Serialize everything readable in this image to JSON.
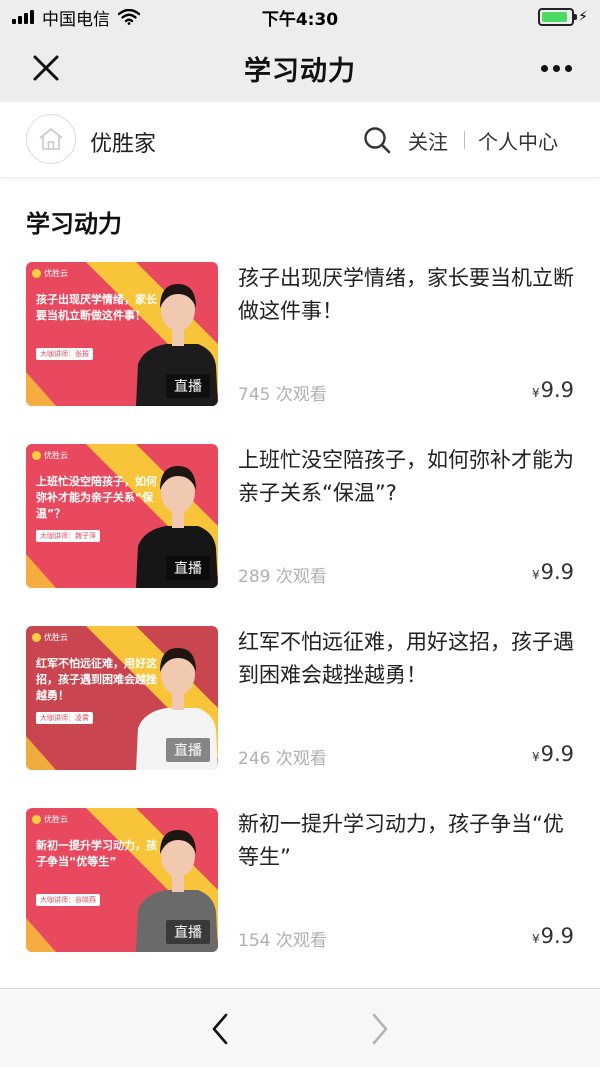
{
  "status_bar": {
    "carrier": "中国电信",
    "time": "下午4:30",
    "battery_level": 0.9,
    "signal_bars": 4
  },
  "nav": {
    "title": "学习动力"
  },
  "shop": {
    "name": "优胜家",
    "follow_label": "关注",
    "personal_center_label": "个人中心"
  },
  "section_title": "学习动力",
  "courses": [
    {
      "title": "孩子出现厌学情绪，家长要当机立断做这件事！",
      "views": "745 次观看",
      "price_symbol": "¥",
      "price": "9.9",
      "badge": "直播",
      "thumb_text": "孩子出现厌学情绪，家长要当机立断做这件事！",
      "thumb_teacher": "大咖讲师：张振",
      "thumb_brand": "优胜云",
      "thumb_bg": "#e9495e",
      "person_suit": "#1c1c1c"
    },
    {
      "title": "上班忙没空陪孩子，如何弥补才能为亲子关系“保温”?",
      "views": "289 次观看",
      "price_symbol": "¥",
      "price": "9.9",
      "badge": "直播",
      "thumb_text": "上班忙没空陪孩子，如何弥补才能为亲子关系“保温”？",
      "thumb_teacher": "大咖讲师：魏子萍",
      "thumb_brand": "优胜云",
      "thumb_bg": "#e9495e",
      "person_suit": "#161616"
    },
    {
      "title": "红军不怕远征难，用好这招，孩子遇到困难会越挫越勇！",
      "views": "246 次观看",
      "price_symbol": "¥",
      "price": "9.9",
      "badge": "直播",
      "thumb_text": "红军不怕远征难，用好这招，孩子遇到困难会越挫越勇！",
      "thumb_teacher": "大咖讲师：凌霄",
      "thumb_brand": "优胜云",
      "thumb_bg": "#c9454f",
      "person_suit": "#f4f4f4"
    },
    {
      "title": "新初一提升学习动力，孩子争当“优等生”",
      "views": "154 次观看",
      "price_symbol": "¥",
      "price": "9.9",
      "badge": "直播",
      "thumb_text": "新初一提升学习动力，孩子争当“优等生”",
      "thumb_teacher": "大咖讲师：谷晓燕",
      "thumb_brand": "优胜云",
      "thumb_bg": "#e9495e",
      "person_suit": "#6a6a6a"
    }
  ],
  "colors": {
    "accent_yellow": "#f8c53a",
    "battery_green": "#4cd964"
  }
}
